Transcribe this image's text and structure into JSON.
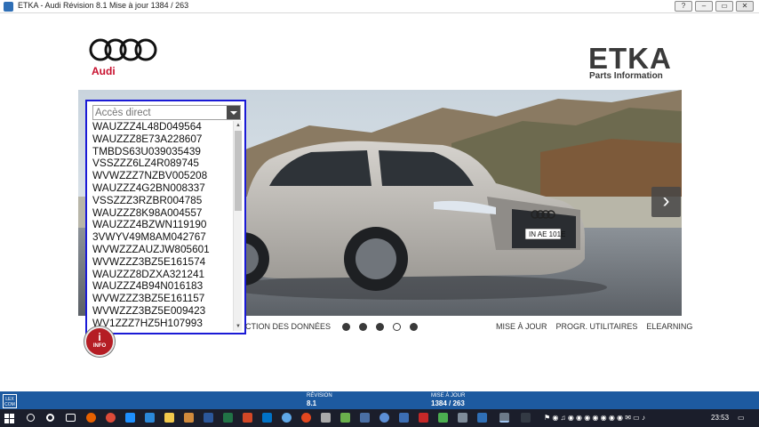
{
  "window": {
    "title": "ETKA - Audi Révision 8.1 Mise à jour 1384 / 263",
    "controls": [
      "?",
      "–",
      "▭",
      "✕"
    ]
  },
  "brand": {
    "name": "Audi",
    "product": "ETKA",
    "product_sub": "Parts Information",
    "colors": {
      "brand_red": "#c8102e",
      "highlight_blue": "#1a1ad6",
      "status_blue": "#1d5aa0"
    }
  },
  "hero": {
    "plate": "IN AE 101E"
  },
  "direct_access": {
    "placeholder": "Accès direct",
    "vins": [
      "WAUZZZ4L48D049564",
      "WAUZZZ8E73A228607",
      "TMBDS63U039035439",
      "VSSZZZ6LZ4R089745",
      "WVWZZZ7NZBV005208",
      "WAUZZZ4G2BN008337",
      "VSSZZZ3RZBR004785",
      "WAUZZZ8K98A004557",
      "WAUZZZ4BZWN119190",
      "3VWYV49M8AM042767",
      "WVWZZZAUZJW805601",
      "WVWZZZ3BZ5E161574",
      "WAUZZZ8DZXA321241",
      "WAUZZZ4B94N016183",
      "WVWZZZ3BZ5E161157",
      "WVWZZZ3BZ5E009423",
      "WV1ZZZ7HZ5H107993"
    ]
  },
  "nav": {
    "partial_link": "CTION DES DONNÉES",
    "links": [
      "MISE À JOUR",
      "PROGR. UTILITAIRES",
      "ELEARNING"
    ],
    "carousel_active_index": 3,
    "carousel_count": 5
  },
  "info_button": {
    "icon": "i",
    "label": "INFO"
  },
  "statusbar": {
    "logo": "LEX COM",
    "revision_label": "RÉVISION",
    "revision_value": "8.1",
    "update_label": "MISE À JOUR",
    "update_value": "1384 / 263"
  },
  "taskbar": {
    "clock": "23:53"
  }
}
